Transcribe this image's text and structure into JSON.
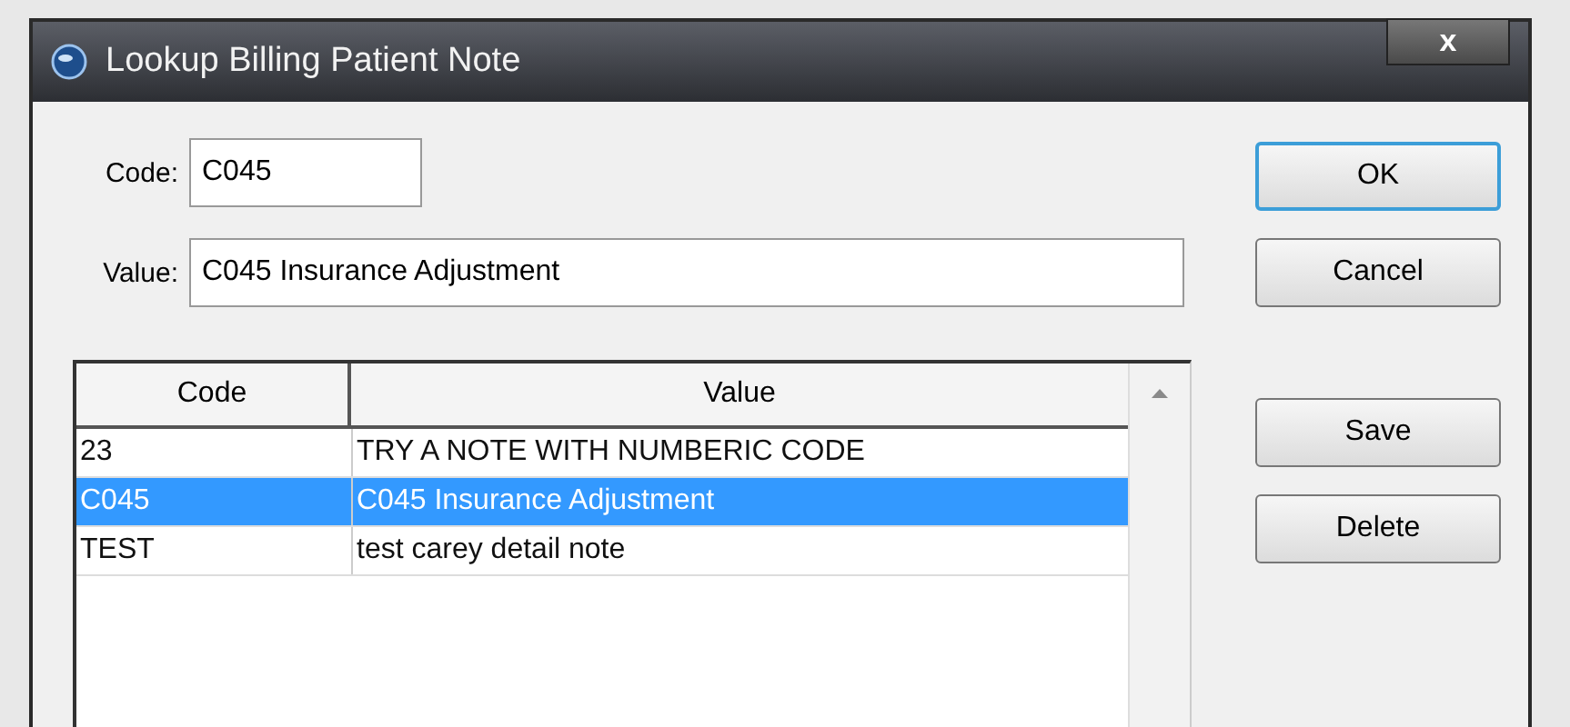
{
  "window": {
    "title": "Lookup Billing Patient Note",
    "close": "x"
  },
  "fields": [
    {
      "label": "Code:",
      "value": "C045"
    },
    {
      "label": "Value:",
      "value": "C045 Insurance Adjustment"
    }
  ],
  "table": {
    "columns": [
      "Code",
      "Value"
    ],
    "rows": [
      {
        "cells": [
          "23",
          "TRY A NOTE WITH NUMBERIC CODE"
        ],
        "selected": false
      },
      {
        "cells": [
          "C045",
          "C045 Insurance Adjustment"
        ],
        "selected": true
      },
      {
        "cells": [
          "TEST",
          "test carey detail note"
        ],
        "selected": false
      }
    ]
  },
  "buttons_top": [
    {
      "label": "OK",
      "default": true
    },
    {
      "label": "Cancel",
      "default": false
    }
  ],
  "buttons_bottom": [
    {
      "label": "Save"
    },
    {
      "label": "Delete"
    }
  ]
}
